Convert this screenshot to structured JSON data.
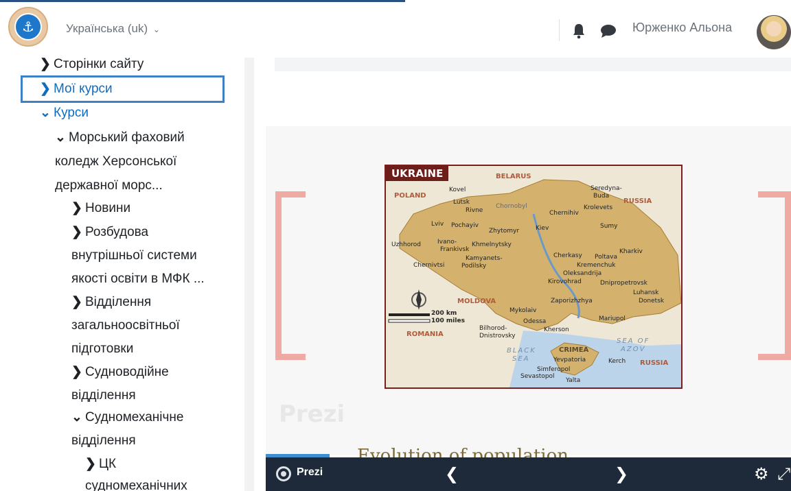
{
  "header": {
    "language": "Українська (uk)",
    "language_chevron": "⌄",
    "user_name": "Юрженко Альона"
  },
  "nav": {
    "items": [
      {
        "label": "Сторінки сайту",
        "arrow": "❯"
      },
      {
        "label": "Мої курси",
        "arrow": "❯"
      },
      {
        "label": "Курси",
        "arrow": "⌄"
      },
      {
        "label_lines": [
          "Морський фаховий",
          "коледж Херсонської",
          "державної морс..."
        ],
        "arrow": "⌄"
      },
      {
        "label": "Новини",
        "arrow": "❯"
      },
      {
        "label_lines": [
          "Розбудова",
          "внутрішньої системи",
          "якості освіти в МФК ..."
        ],
        "arrow": "❯"
      },
      {
        "label_lines": [
          "Відділення",
          "загальноосвітньої",
          "підготовки"
        ],
        "arrow": "❯"
      },
      {
        "label_lines": [
          "Судноводійне",
          "відділення"
        ],
        "arrow": "❯"
      },
      {
        "label_lines": [
          "Судномеханічне",
          "відділення"
        ],
        "arrow": "⌄"
      },
      {
        "label_lines": [
          "ЦК",
          "судномеханічних"
        ],
        "arrow": "❯"
      }
    ]
  },
  "prezi": {
    "map_title": "UKRAINE",
    "map_labels": {
      "belarus": "BELARUS",
      "poland": "POLAND",
      "russia_n": "RUSSIA",
      "moldova": "MOLDOVA",
      "romania": "ROMANIA",
      "russia_s": "RUSSIA",
      "black_sea_1": "BLACK",
      "black_sea_2": "SEA",
      "azov_1": "SEA OF",
      "azov_2": "AZOV",
      "crimea": "CRIMEA",
      "kovel": "Kovel",
      "lutsk": "Lutsk",
      "rivne": "Rivne",
      "chornobyl": "Chornobyl",
      "chernihiv": "Chernihiv",
      "seredyna_1": "Seredyna-",
      "seredyna_2": "Buda",
      "krolevets": "Krolevets",
      "lviv": "Lviv",
      "pochayiv": "Pochayiv",
      "zhytomyr": "Zhytomyr",
      "kiev": "Kiev",
      "sumy": "Sumy",
      "uzhhorod": "Uzhhorod",
      "ivano_1": "Ivano-",
      "ivano_2": "Frankivsk",
      "khmelnytsky": "Khmelnytsky",
      "kharkiv": "Kharkiv",
      "chernivtsi": "Chernivtsi",
      "kamyanets_1": "Kamyanets-",
      "kamyanets_2": "Podilsky",
      "cherkasy": "Cherkasy",
      "poltava": "Poltava",
      "kremenchuk": "Kremenchuk",
      "oleksandrija": "Oleksandrija",
      "kirovohrad": "Kirovohrad",
      "dnipro": "Dnipropetrovsk",
      "luhansk": "Luhansk",
      "donetsk": "Donetsk",
      "zaporizhzhya": "Zaporizhzhya",
      "mykolaiv": "Mykolaiv",
      "odessa": "Odessa",
      "kherson": "Kherson",
      "mariupol": "Mariupol",
      "bilhorod_1": "Bilhorod-",
      "bilhorod_2": "Dnistrovsky",
      "yevpatoria": "Yevpatoria",
      "kerch": "Kerch",
      "simferopol": "Simferopol",
      "sevastopol": "Sevastopol",
      "yalta": "Yalta",
      "scale_km": "200 km",
      "scale_mi": "100 miles"
    },
    "watermark": "Prezi",
    "slide_text": "Evolution of population",
    "controls": {
      "brand": "Prezi",
      "prev": "❮",
      "next": "❯",
      "settings": "⚙",
      "fullscreen": "⤢"
    }
  }
}
